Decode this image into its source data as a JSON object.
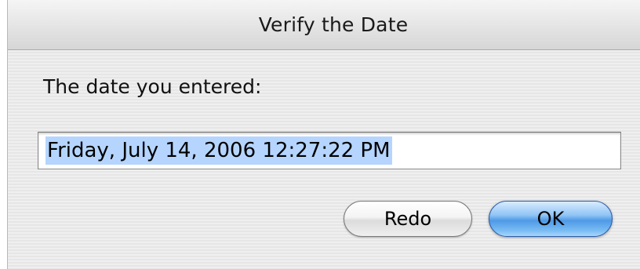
{
  "dialog": {
    "title": "Verify the Date",
    "prompt": "The date you entered:",
    "date_value": "Friday, July 14, 2006 12:27:22 PM",
    "buttons": {
      "redo_label": "Redo",
      "ok_label": "OK"
    },
    "colors": {
      "selection_highlight": "#b5d5ff",
      "default_button": "#4f99e6"
    }
  }
}
